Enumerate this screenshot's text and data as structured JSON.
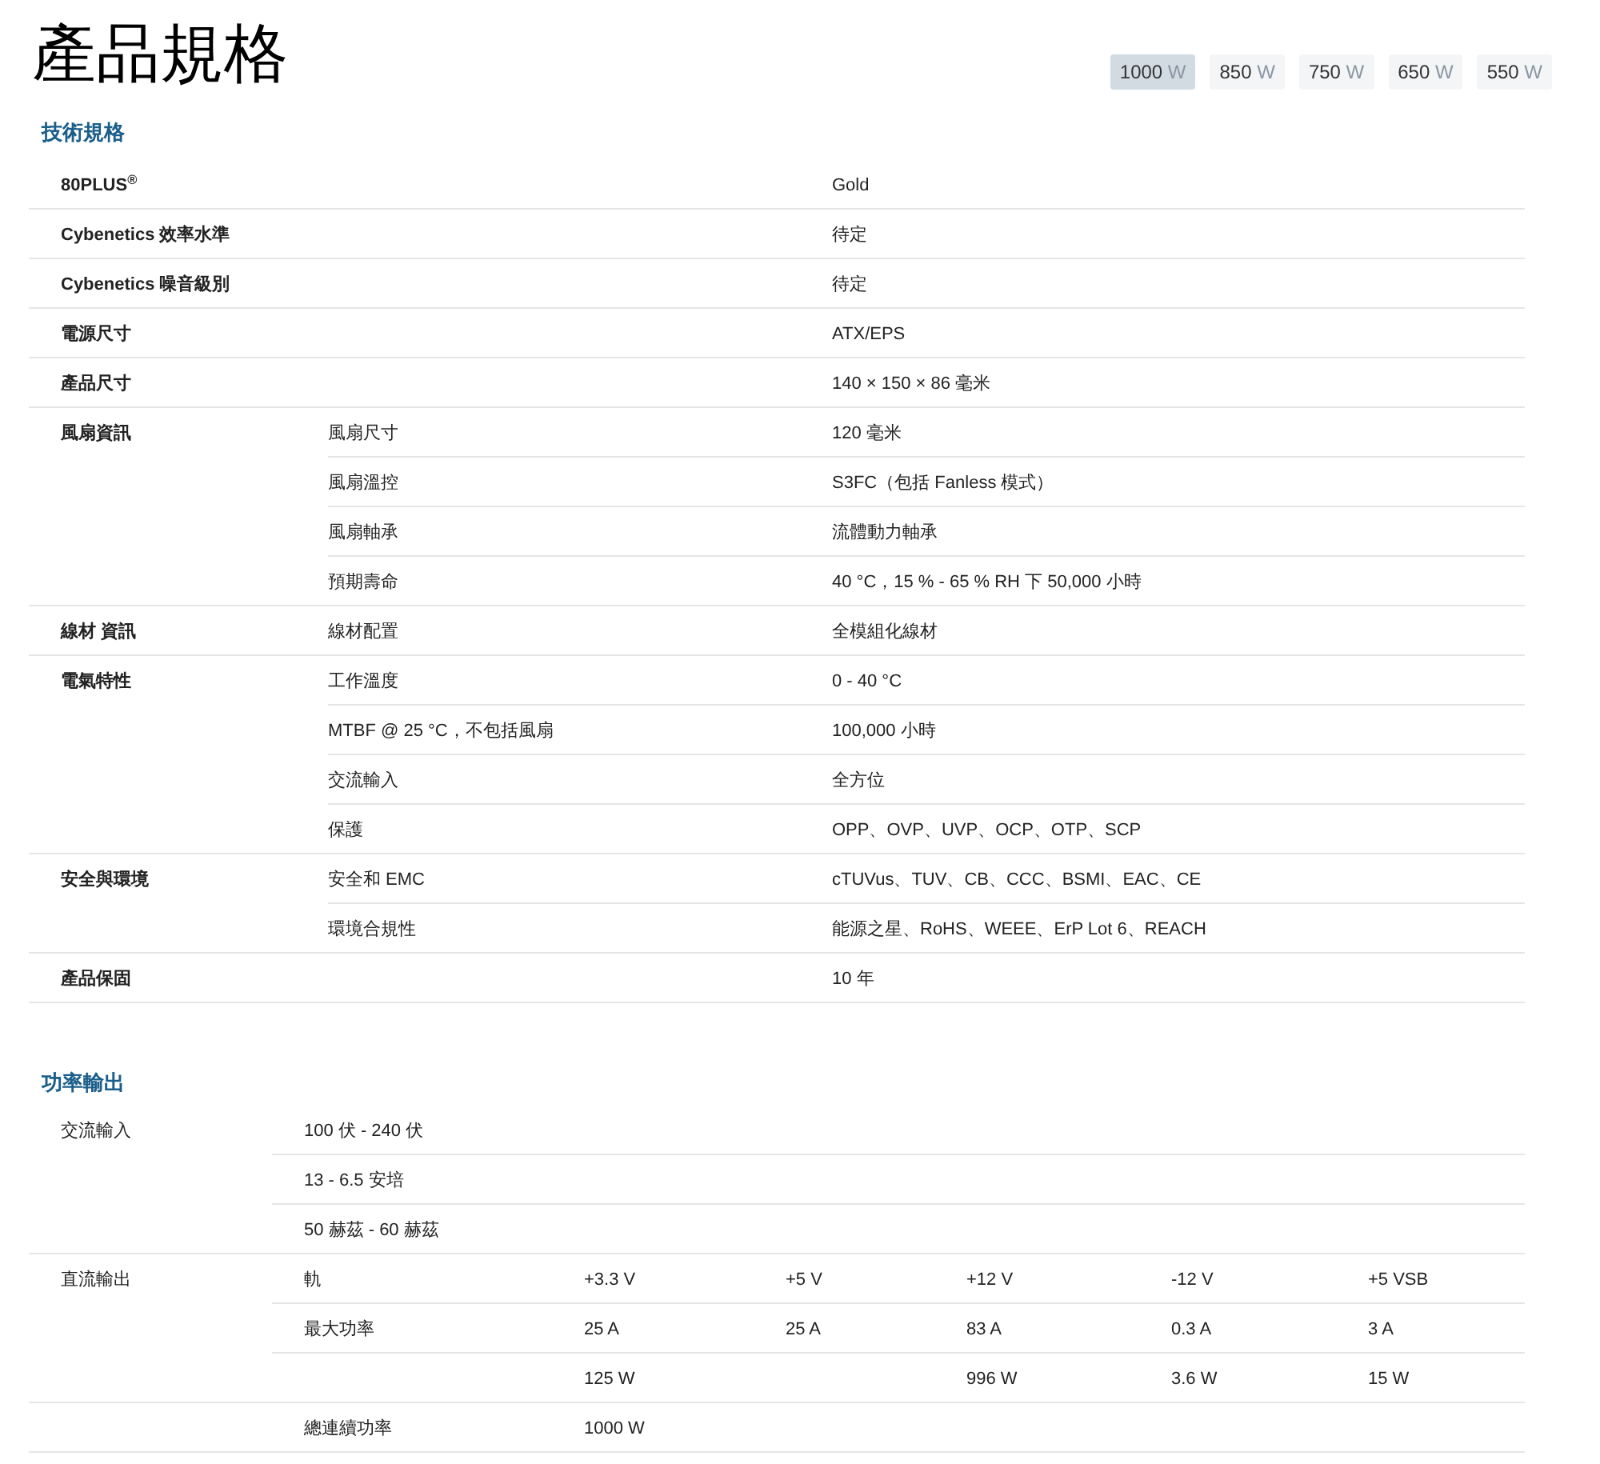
{
  "page_title": "產品規格",
  "wattage_tabs": [
    {
      "value": "1000",
      "unit": "W",
      "selected": true
    },
    {
      "value": "850",
      "unit": "W",
      "selected": false
    },
    {
      "value": "750",
      "unit": "W",
      "selected": false
    },
    {
      "value": "650",
      "unit": "W",
      "selected": false
    },
    {
      "value": "550",
      "unit": "W",
      "selected": false
    }
  ],
  "tech_specs": {
    "title": "技術規格",
    "groups": [
      {
        "label": "80PLUS$^{®}$",
        "items": [
          {
            "value": "Gold"
          }
        ]
      },
      {
        "label": "Cybenetics 效率水準",
        "items": [
          {
            "value": "待定"
          }
        ]
      },
      {
        "label": "Cybenetics 噪音級別",
        "items": [
          {
            "value": "待定"
          }
        ]
      },
      {
        "label": "電源尺寸",
        "items": [
          {
            "value": "ATX/EPS"
          }
        ]
      },
      {
        "label": "產品尺寸",
        "items": [
          {
            "value": "140 × 150 × 86 毫米"
          }
        ]
      },
      {
        "label": "風扇資訊",
        "items": [
          {
            "name": "風扇尺寸",
            "value": "120 毫米"
          },
          {
            "name": "風扇溫控",
            "value": "S3FC（包括 Fanless 模式）"
          },
          {
            "name": "風扇軸承",
            "value": "流體動力軸承"
          },
          {
            "name": "預期壽命",
            "value": "40 °C，15 % - 65 % RH 下 50,000 小時"
          }
        ]
      },
      {
        "label": "線材 資訊",
        "items": [
          {
            "name": "線材配置",
            "value": "全模組化線材"
          }
        ]
      },
      {
        "label": "電氣特性",
        "items": [
          {
            "name": "工作溫度",
            "value": "0 - 40 °C"
          },
          {
            "name": "MTBF @ 25 °C，不包括風扇",
            "value": "100,000 小時"
          },
          {
            "name": "交流輸入",
            "value": "全方位"
          },
          {
            "name": "保護",
            "value": "OPP、OVP、UVP、OCP、OTP、SCP"
          }
        ]
      },
      {
        "label": "安全與環境",
        "items": [
          {
            "name": "安全和 EMC",
            "value": "cTUVus、TUV、CB、CCC、BSMI、EAC、CE"
          },
          {
            "name": "環境合規性",
            "value": "能源之星、RoHS、WEEE、ErP Lot 6、REACH"
          }
        ]
      },
      {
        "label": "產品保固",
        "items": [
          {
            "value": "10 年"
          }
        ]
      }
    ]
  },
  "power_output": {
    "title": "功率輸出",
    "groups": [
      {
        "label": "交流輸入",
        "rows": [
          {
            "values": [
              "100 伏 - 240 伏"
            ]
          },
          {
            "values": [
              "13 - 6.5 安培"
            ]
          },
          {
            "values": [
              "50 赫茲 - 60 赫茲"
            ]
          }
        ]
      },
      {
        "label": "直流輸出",
        "rows": [
          {
            "name": "軌",
            "values": [
              "+3.3 V",
              "+5 V",
              "+12 V",
              "-12 V",
              "+5 VSB"
            ]
          },
          {
            "name": "最大功率",
            "values": [
              "25 A",
              "25 A",
              "83 A",
              "0.3 A",
              "3 A"
            ]
          },
          {
            "values": [
              "125 W",
              "996 W",
              "3.6 W",
              "15 W"
            ],
            "first_spans_two": true
          }
        ]
      },
      {
        "rows": [
          {
            "name": "總連續功率",
            "values": [
              "1000 W"
            ]
          }
        ]
      }
    ]
  }
}
